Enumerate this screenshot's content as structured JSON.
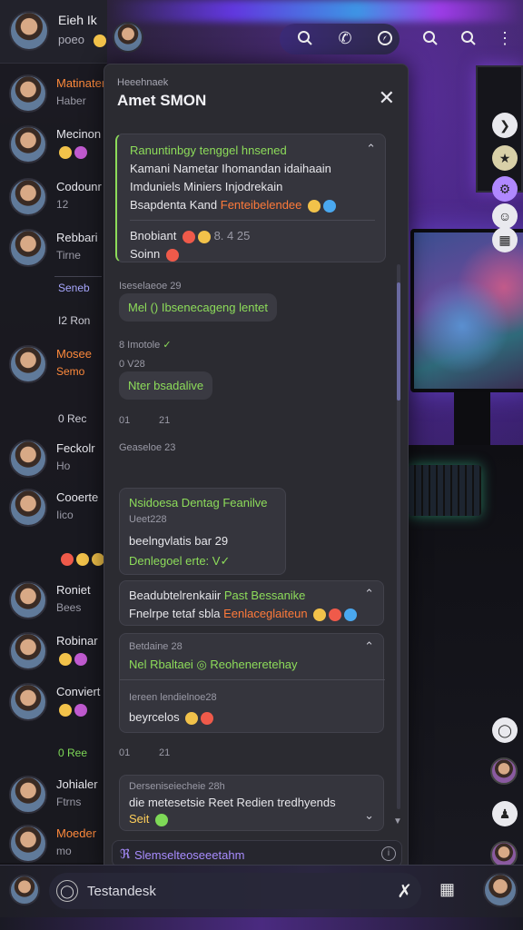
{
  "app": {
    "chat_title": "Amet SMON",
    "chat_subtitle": "Heeehnaek"
  },
  "list": {
    "header": {
      "name": "Eieh Ik",
      "sub": "poeo"
    },
    "items": [
      {
        "name": "Matinater",
        "sub": "Haber",
        "accent": "#ff8a3c"
      },
      {
        "name": "Mecinon",
        "sub": ""
      },
      {
        "name": "Codounr",
        "sub": "12"
      },
      {
        "name": "Rebbari",
        "sub": "Tirne"
      },
      {
        "name": "Mosee",
        "sub": "Semo",
        "accent": "#ff8a3c"
      },
      {
        "name": "Feckolr",
        "sub": "Ho"
      },
      {
        "name": "Cooerte",
        "sub": "Iico"
      },
      {
        "name": "Roniet",
        "sub": "Bees"
      },
      {
        "name": "Robinar",
        "sub": ""
      },
      {
        "name": "Conviert",
        "sub": ""
      },
      {
        "name": "Johialer",
        "sub": "Ftrns"
      },
      {
        "name": "Moeder",
        "sub": "mo",
        "accent": "#ff8a3c"
      }
    ],
    "separators": [
      {
        "label": "Seneb"
      },
      {
        "label": "I2 Ron"
      },
      {
        "label": "0 Rec"
      },
      {
        "label": "0 Ree",
        "accent": "green"
      }
    ]
  },
  "messages": {
    "card1": {
      "head": "Ranuntinbgy tenggel hnsened",
      "l1": "Kamani Nametar Ihomandan idaihaain",
      "l2": "Imduniels Miniers Injodrekain",
      "l3a": "Bsapdenta Kand",
      "l3b": "Fenteibelendee",
      "foot1": "Bnobiant",
      "foot1_meta": "8. 4 25",
      "foot2": "Soinn"
    },
    "meta1": "Iseselaeoe 29",
    "b1": "Mel () Ibsenecageng lentet",
    "b1_meta": "8 Imotole",
    "meta2": "0 V28",
    "b2": "Nter bsadalive",
    "t1a": "01",
    "t1b": "21",
    "meta3": "Geaseloe 23",
    "card2": {
      "head": "Nsidoesa Dentag Feanilve",
      "sub": "Ueet228",
      "l1": "beelngvlatis bar 29",
      "l2": "Denlegoel erte: V"
    },
    "card3": {
      "a": "Beadubtelrenkaiir",
      "b": "Past Bessanike",
      "c": "Fnelrpe tetaf sbla",
      "d": "Eenlaceglaiteun"
    },
    "card4": {
      "meta": "Betdaine 28",
      "l1": "Nel Rbaltaei",
      "l2": "Reoheneretehay",
      "meta2": "Iereen lendielnoe28",
      "l3": "beyrcelos"
    },
    "t2a": "01",
    "t2b": "21",
    "card5": {
      "meta": "Derseniseiecheie 28h",
      "l1": "die metesetsie Reet Redien tredhyends",
      "l2": "Seit"
    },
    "composer_placeholder": "Slemselteoseeetahm"
  },
  "bottom": {
    "input_placeholder": "Testandesk"
  }
}
